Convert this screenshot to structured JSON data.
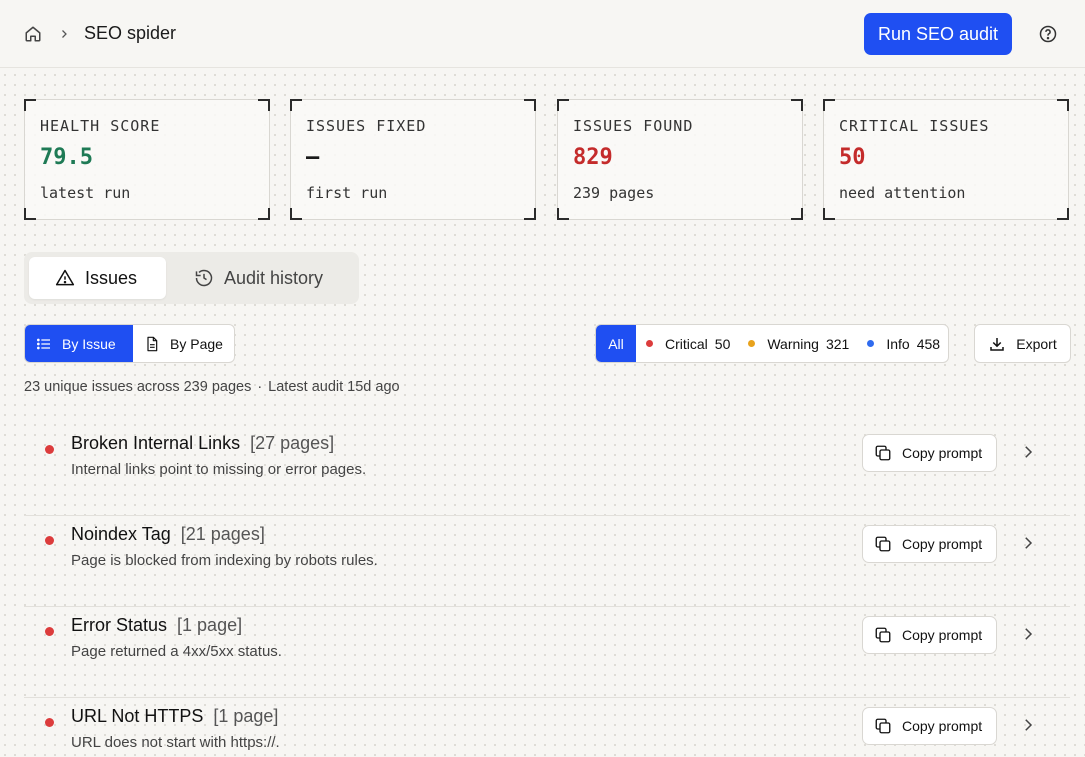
{
  "header": {
    "home_icon": "home-icon",
    "breadcrumb_title": "SEO spider",
    "run_button": "Run SEO audit",
    "help_icon": "help-circle-icon",
    "accent_color": "#1f4ff2"
  },
  "stats": [
    {
      "label": "HEALTH SCORE",
      "value": "79.5",
      "sub": "latest run",
      "color": "#1e7a55"
    },
    {
      "label": "ISSUES FIXED",
      "value": "—",
      "sub": "first run",
      "color": "#1a1a1a"
    },
    {
      "label": "ISSUES FOUND",
      "value": "829",
      "sub": "239 pages",
      "color": "#c42b2b"
    },
    {
      "label": "CRITICAL ISSUES",
      "value": "50",
      "sub": "need attention",
      "color": "#c42b2b"
    }
  ],
  "tabs": [
    {
      "label": "Issues",
      "icon": "warning-triangle-icon",
      "active": true
    },
    {
      "label": "Audit history",
      "icon": "history-icon",
      "active": false
    }
  ],
  "view_toggle": [
    {
      "label": "By Issue",
      "icon": "list-icon",
      "active": true
    },
    {
      "label": "By Page",
      "icon": "document-icon",
      "active": false
    }
  ],
  "filters": {
    "all": "All",
    "items": [
      {
        "label": "Critical",
        "count": "50",
        "color": "#dc3c3c"
      },
      {
        "label": "Warning",
        "count": "321",
        "color": "#e8a21c"
      },
      {
        "label": "Info",
        "count": "458",
        "color": "#2f6bef"
      }
    ]
  },
  "export_button": "Export",
  "summary": {
    "issues_text": "23 unique issues across 239 pages",
    "audit_text": "Latest audit 15d ago"
  },
  "issues": [
    {
      "title": "Broken Internal Links",
      "count": "[27 pages]",
      "desc": "Internal links point to missing or error pages.",
      "copy": "Copy prompt"
    },
    {
      "title": "Noindex Tag",
      "count": "[21 pages]",
      "desc": "Page is blocked from indexing by robots rules.",
      "copy": "Copy prompt"
    },
    {
      "title": "Error Status",
      "count": "[1 page]",
      "desc": "Page returned a 4xx/5xx status.",
      "copy": "Copy prompt"
    },
    {
      "title": "URL Not HTTPS",
      "count": "[1 page]",
      "desc": "URL does not start with https://.",
      "copy": "Copy prompt"
    }
  ]
}
